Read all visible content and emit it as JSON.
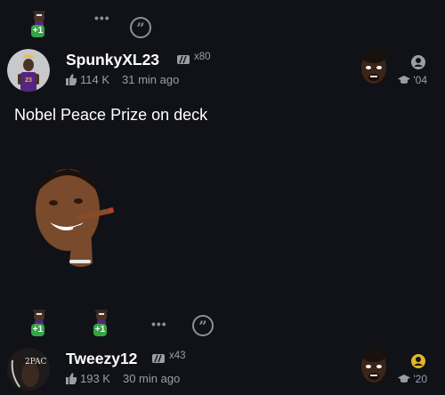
{
  "top_reactions": {
    "reaction_1": {
      "icon": "lebron-emoji-icon",
      "count": "+1"
    },
    "more_label": "•••",
    "quote_label": "”"
  },
  "post_1": {
    "username": "SpunkyXL23",
    "multiplier": "x80",
    "likes": "114 K",
    "time": "31 min ago",
    "grad_year": "'04",
    "text": "Nobel Peace Prize on deck",
    "image_icon": "obama-cigar-sticker"
  },
  "mid_reactions": {
    "reaction_1": {
      "icon": "lebron-emoji-icon",
      "count": "+1"
    },
    "reaction_2": {
      "icon": "lebron-emoji-icon",
      "count": "+1"
    },
    "more_label": "•••",
    "quote_label": "”"
  },
  "post_2": {
    "username": "Tweezy12",
    "multiplier": "x43",
    "likes": "193 K",
    "time": "30 min ago",
    "grad_year": "'20",
    "avatar_text": "2PAC"
  },
  "colors": {
    "background": "#111217",
    "badge_green": "#35a447",
    "muted": "#9b9ea8",
    "online_yellow": "#e0b62a"
  }
}
